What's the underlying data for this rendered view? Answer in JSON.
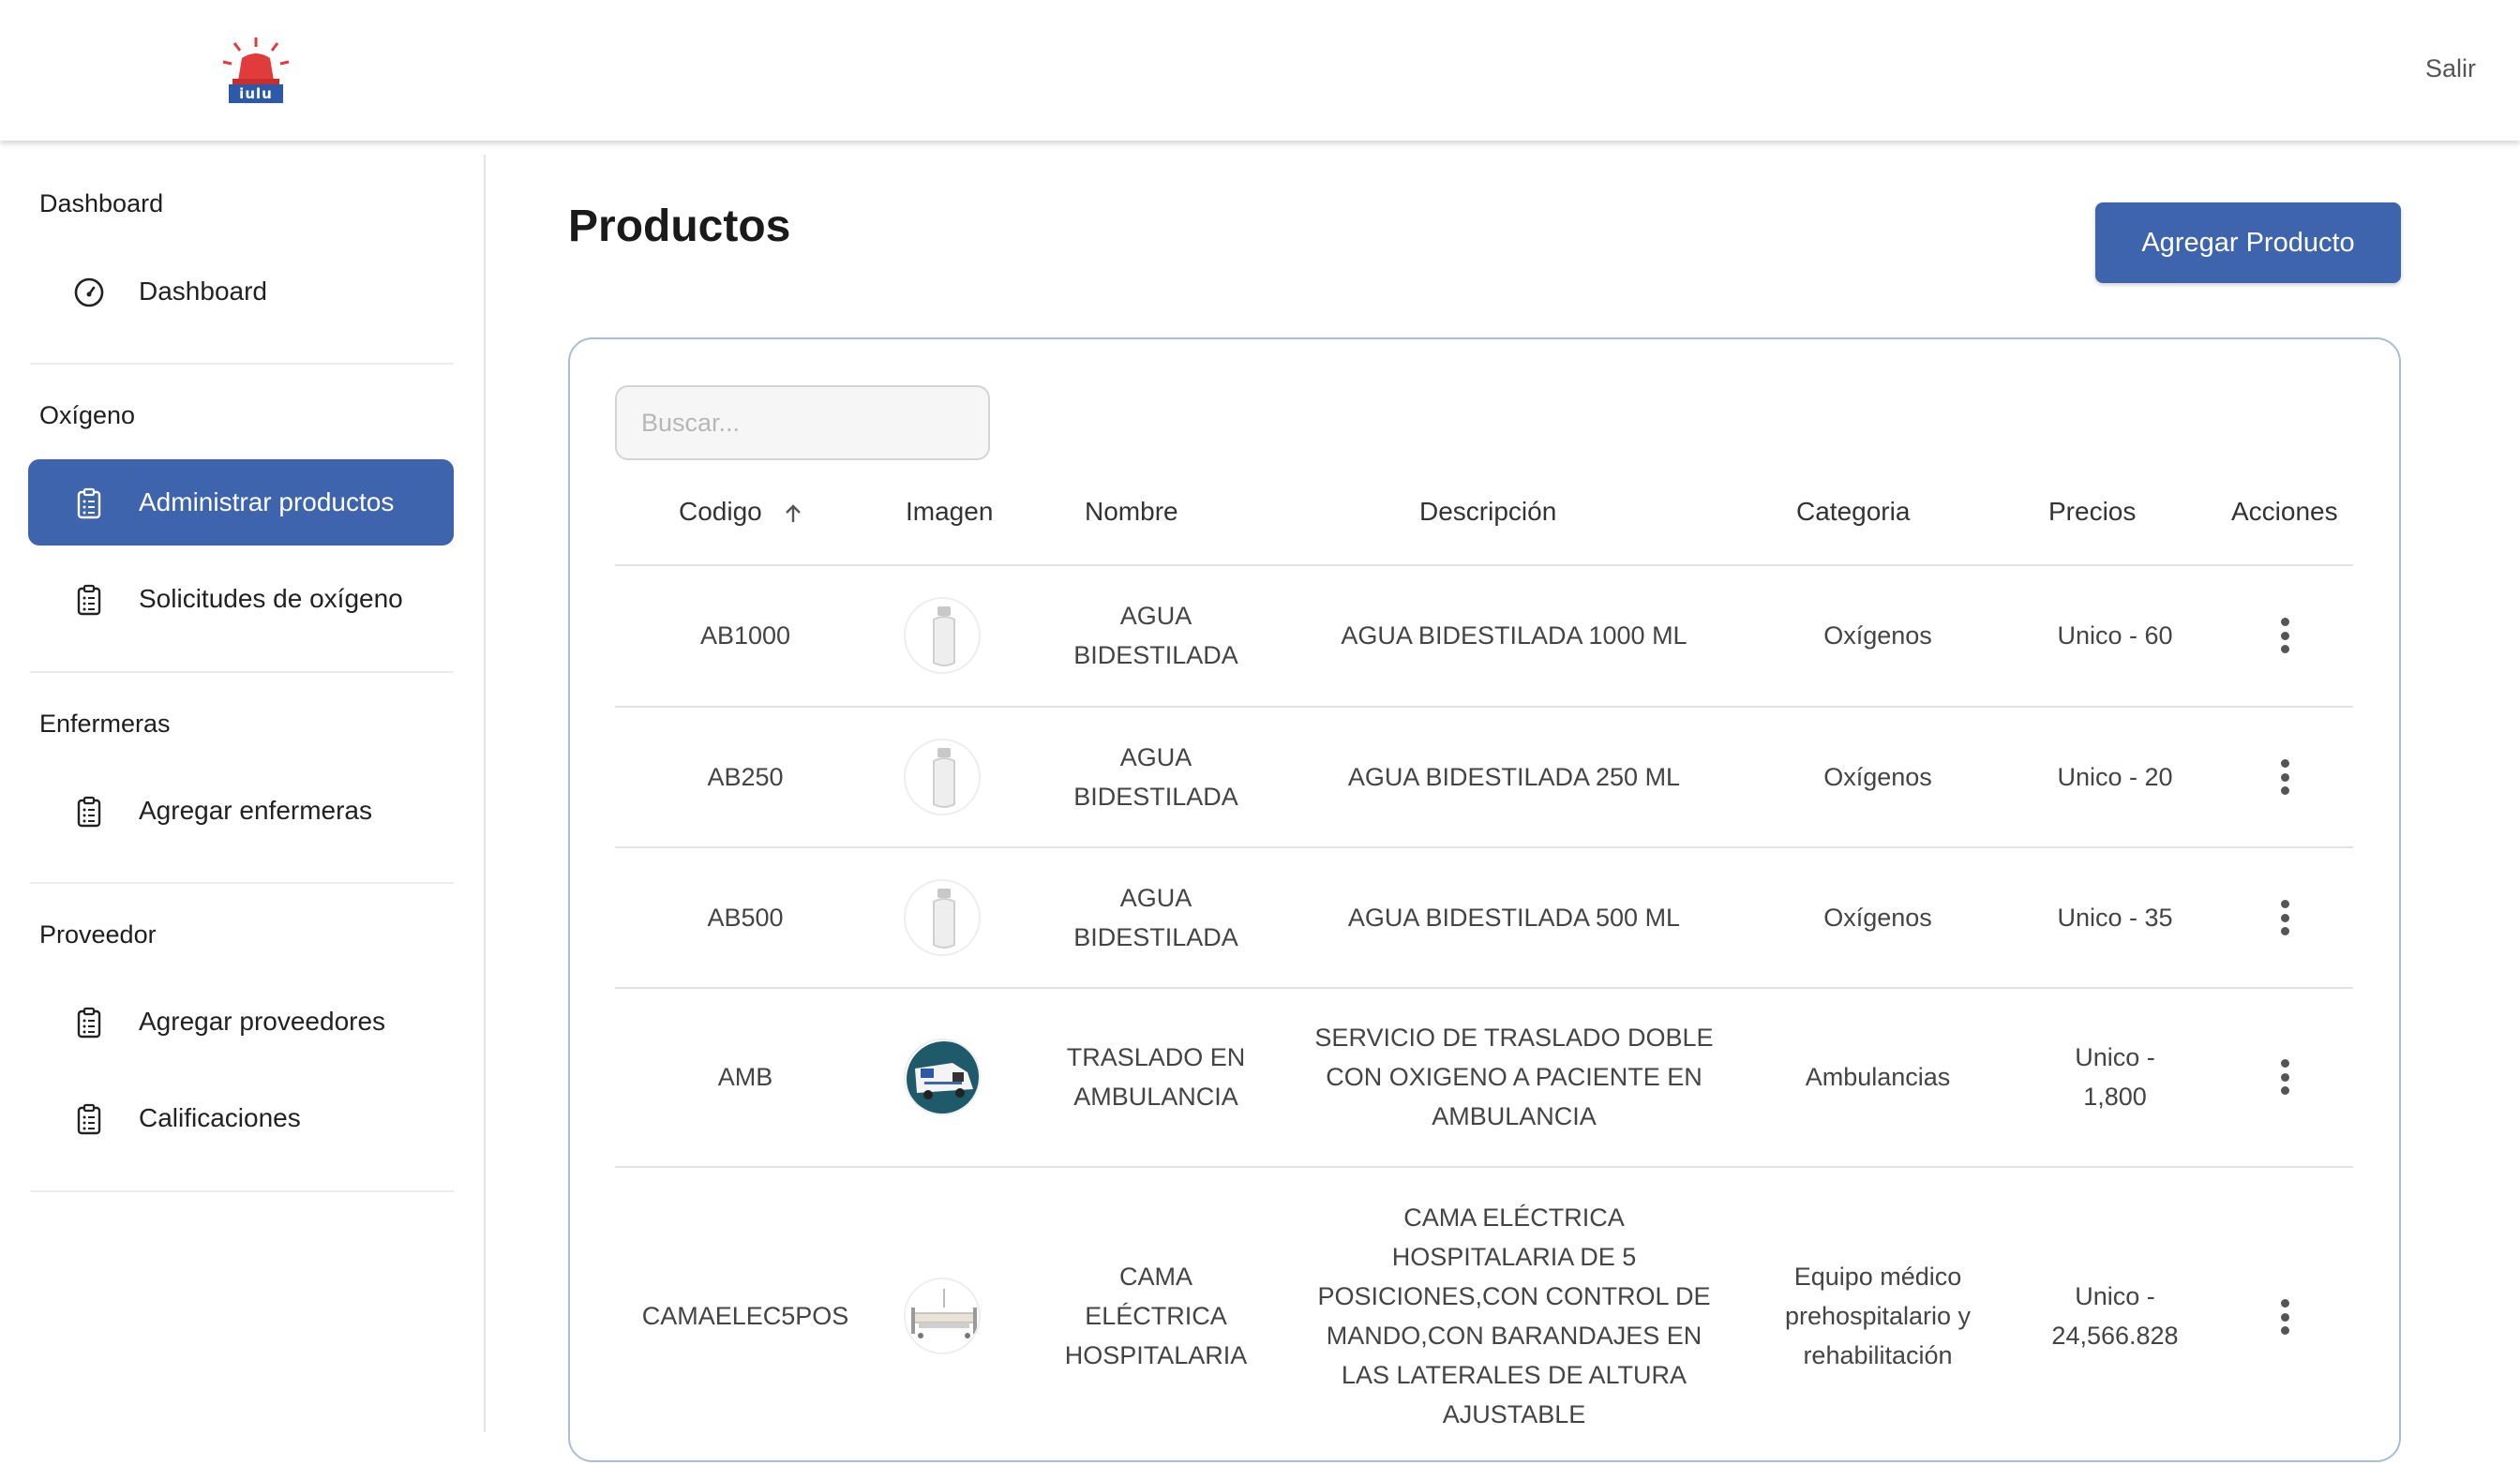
{
  "header": {
    "logo_text": "iulu",
    "logout_label": "Salir"
  },
  "sidebar": {
    "sections": [
      {
        "title": "Dashboard",
        "items": [
          {
            "label": "Dashboard",
            "icon": "speedometer-icon"
          }
        ]
      },
      {
        "title": "Oxígeno",
        "items": [
          {
            "label": "Administrar productos",
            "icon": "clipboard-list-icon",
            "active": true
          },
          {
            "label": "Solicitudes de oxígeno",
            "icon": "clipboard-list-icon"
          }
        ]
      },
      {
        "title": "Enfermeras",
        "items": [
          {
            "label": "Agregar enfermeras",
            "icon": "clipboard-list-icon"
          }
        ]
      },
      {
        "title": "Proveedor",
        "items": [
          {
            "label": "Agregar proveedores",
            "icon": "clipboard-list-icon"
          },
          {
            "label": "Calificaciones",
            "icon": "clipboard-list-icon"
          }
        ]
      }
    ]
  },
  "main": {
    "title": "Productos",
    "add_button_label": "Agregar Producto",
    "search_placeholder": "Buscar...",
    "columns": [
      "Codigo",
      "Imagen",
      "Nombre",
      "Descripción",
      "Categoria",
      "Precios",
      "Acciones"
    ],
    "sort_icon": "arrow-up-icon",
    "rows": [
      {
        "codigo": "AB1000",
        "image": "water-bottle",
        "nombre": "AGUA BIDESTILADA",
        "descripcion": "AGUA BIDESTILADA 1000 ML",
        "categoria": "Oxígenos",
        "precio": "Unico - 60"
      },
      {
        "codigo": "AB250",
        "image": "water-bottle",
        "nombre": "AGUA BIDESTILADA",
        "descripcion": "AGUA BIDESTILADA 250 ML",
        "categoria": "Oxígenos",
        "precio": "Unico - 20"
      },
      {
        "codigo": "AB500",
        "image": "water-bottle",
        "nombre": "AGUA BIDESTILADA",
        "descripcion": "AGUA BIDESTILADA 500 ML",
        "categoria": "Oxígenos",
        "precio": "Unico - 35"
      },
      {
        "codigo": "AMB",
        "image": "ambulance",
        "nombre": "TRASLADO EN AMBULANCIA",
        "descripcion": "SERVICIO DE TRASLADO DOBLE CON OXIGENO A PACIENTE EN AMBULANCIA",
        "categoria": "Ambulancias",
        "precio": "Unico - 1,800"
      },
      {
        "codigo": "CAMAELEC5POS",
        "image": "hospital-bed",
        "nombre": "CAMA ELÉCTRICA HOSPITALARIA",
        "descripcion": "CAMA ELÉCTRICA HOSPITALARIA DE 5 POSICIONES,CON CONTROL DE MANDO,CON BARANDAJES EN LAS LATERALES DE ALTURA AJUSTABLE",
        "categoria": "Equipo médico prehospitalario y rehabilitación",
        "precio": "Unico - 24,566.828"
      }
    ]
  },
  "colors": {
    "primary": "#3d64ad",
    "logo_red": "#e23b3b",
    "card_border": "#a9bdd6"
  }
}
